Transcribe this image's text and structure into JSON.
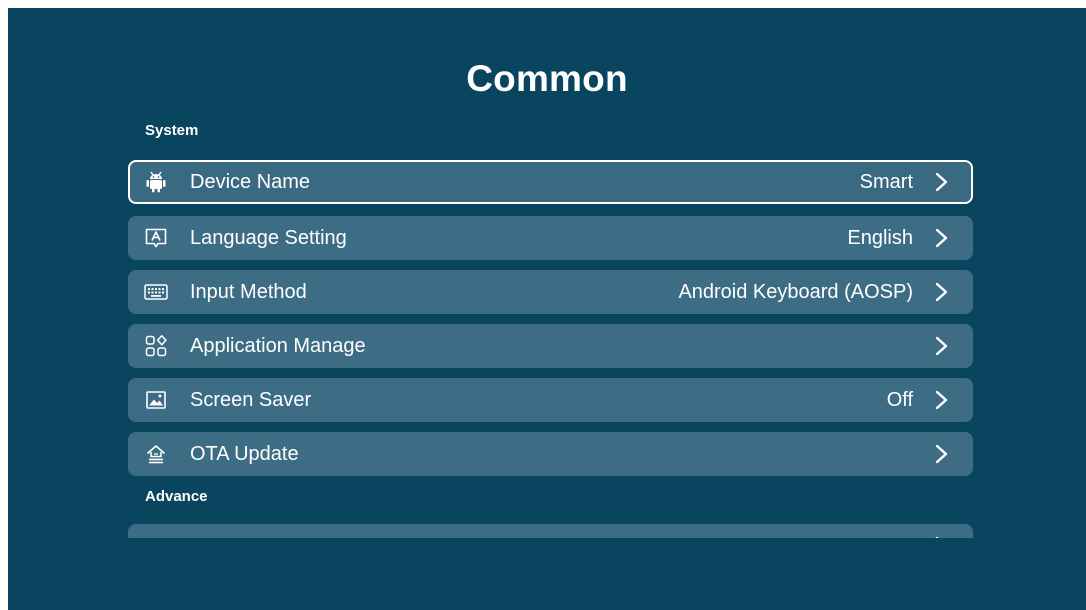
{
  "page": {
    "title": "Common"
  },
  "sections": {
    "system": "System",
    "advance": "Advance"
  },
  "items": [
    {
      "label": "Device Name",
      "value": "Smart",
      "icon": "android-icon"
    },
    {
      "label": "Language Setting",
      "value": "English",
      "icon": "language-icon"
    },
    {
      "label": "Input Method",
      "value": "Android Keyboard (AOSP)",
      "icon": "keyboard-icon"
    },
    {
      "label": "Application Manage",
      "value": "",
      "icon": "apps-icon"
    },
    {
      "label": "Screen Saver",
      "value": "Off",
      "icon": "image-icon"
    },
    {
      "label": "OTA Update",
      "value": "",
      "icon": "update-icon"
    }
  ],
  "colors": {
    "background": "#0a4560",
    "row": "#3d6d85",
    "focus_border": "#ffffff"
  }
}
